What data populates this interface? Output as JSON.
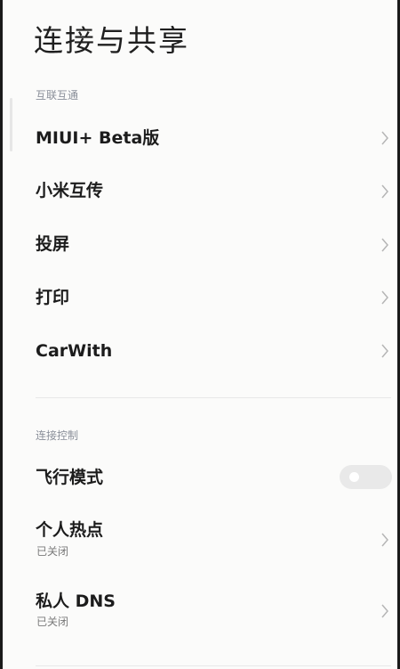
{
  "page": {
    "title": "连接与共享"
  },
  "sections": [
    {
      "label": "互联互通",
      "items": [
        {
          "title": "MIUI+ Beta版"
        },
        {
          "title": "小米互传"
        },
        {
          "title": "投屏"
        },
        {
          "title": "打印"
        },
        {
          "title": "CarWith"
        }
      ]
    },
    {
      "label": "连接控制",
      "items": [
        {
          "title": "飞行模式",
          "toggle_on": false
        },
        {
          "title": "个人热点",
          "subtitle": "已关闭"
        },
        {
          "title": "私人 DNS",
          "subtitle": "已关闭"
        }
      ]
    }
  ],
  "colors": {
    "background": "#fbfbfa",
    "section_label": "#8a8f99",
    "toggle_off": "#e9e9e9"
  },
  "icons": {
    "row_arrow": "chevron-right-icon"
  }
}
